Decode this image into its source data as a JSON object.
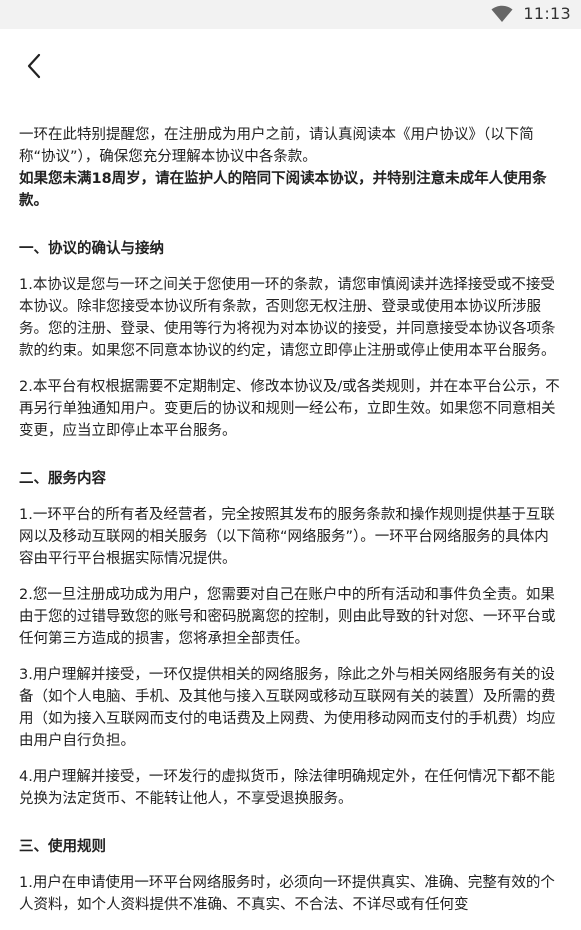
{
  "status_bar": {
    "time": "11:13",
    "wifi_icon": "wifi-icon"
  },
  "nav": {
    "back_icon": "chevron-left-icon"
  },
  "intro": {
    "text": "一环在此特别提醒您，在注册成为用户之前，请认真阅读本《用户协议》（以下简称“协议”），确保您充分理解本协议中各条款。",
    "bold_text": "如果您未满18周岁，请在监护人的陪同下阅读本协议，并特别注意未成年人使用条款。"
  },
  "sections": [
    {
      "title": "一、协议的确认与接纳",
      "paragraphs": [
        "1.本协议是您与一环之间关于您使用一环的条款，请您审慎阅读并选择接受或不接受本协议。除非您接受本协议所有条款，否则您无权注册、登录或使用本协议所涉服务。您的注册、登录、使用等行为将视为对本协议的接受，并同意接受本协议各项条款的约束。如果您不同意本协议的约定，请您立即停止注册或停止使用本平台服务。",
        "2.本平台有权根据需要不定期制定、修改本协议及/或各类规则，并在本平台公示，不再另行单独通知用户。变更后的协议和规则一经公布，立即生效。如果您不同意相关变更，应当立即停止本平台服务。"
      ]
    },
    {
      "title": "二、服务内容",
      "paragraphs": [
        "1.一环平台的所有者及经营者，完全按照其发布的服务条款和操作规则提供基于互联网以及移动互联网的相关服务（以下简称“网络服务”）。一环平台网络服务的具体内容由平行平台根据实际情况提供。",
        "2.您一旦注册成功成为用户，您需要对自己在账户中的所有活动和事件负全责。如果由于您的过错导致您的账号和密码脱离您的控制，则由此导致的针对您、一环平台或任何第三方造成的损害，您将承担全部责任。",
        "3.用户理解并接受，一环仅提供相关的网络服务，除此之外与相关网络服务有关的设备（如个人电脑、手机、及其他与接入互联网或移动互联网有关的装置）及所需的费用（如为接入互联网而支付的电话费及上网费、为使用移动网而支付的手机费）均应由用户自行负担。",
        "4.用户理解并接受，一环发行的虚拟货币，除法律明确规定外，在任何情况下都不能兑换为法定货币、不能转让他人，不享受退换服务。"
      ]
    },
    {
      "title": "三、使用规则",
      "paragraphs": [
        "1.用户在申请使用一环平台网络服务时，必须向一环提供真实、准确、完整有效的个人资料，如个人资料提供不准确、不真实、不合法、不详尽或有任何变"
      ]
    }
  ]
}
